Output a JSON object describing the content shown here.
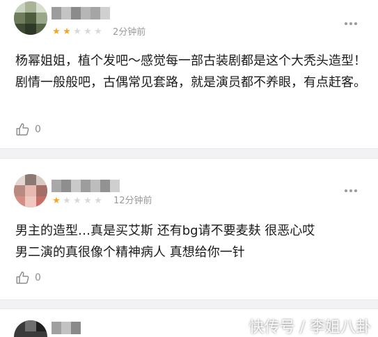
{
  "reviews": [
    {
      "rating": 2,
      "max_rating": 5,
      "time": "2分钟前",
      "text": "杨幂姐姐，植个发吧～感觉每一部古装剧都是这个大秃头造型！剧情一般般吧，古偶常见套路，就是演员都不养眼，有点赶客。",
      "like_count": "0"
    },
    {
      "rating": 1,
      "max_rating": 5,
      "time": "12分钟前",
      "text_line_1": "男主的造型…真是买艾斯 还有bg请不要麦麸 很恶心哎",
      "text_line_2": "男二演的真很像个精神病人 真想给你一针",
      "like_count": "0"
    }
  ],
  "watermark": "快传号 / 李姐八卦",
  "colors": {
    "star_on": "#f5a623",
    "star_off": "#d9d9d9",
    "meta_gray": "#9a9a9a",
    "separator": "#f2f2f4"
  },
  "icons": {
    "like": "thumbs-up-icon",
    "more": "more-dots-icon",
    "star": "star-icon"
  }
}
